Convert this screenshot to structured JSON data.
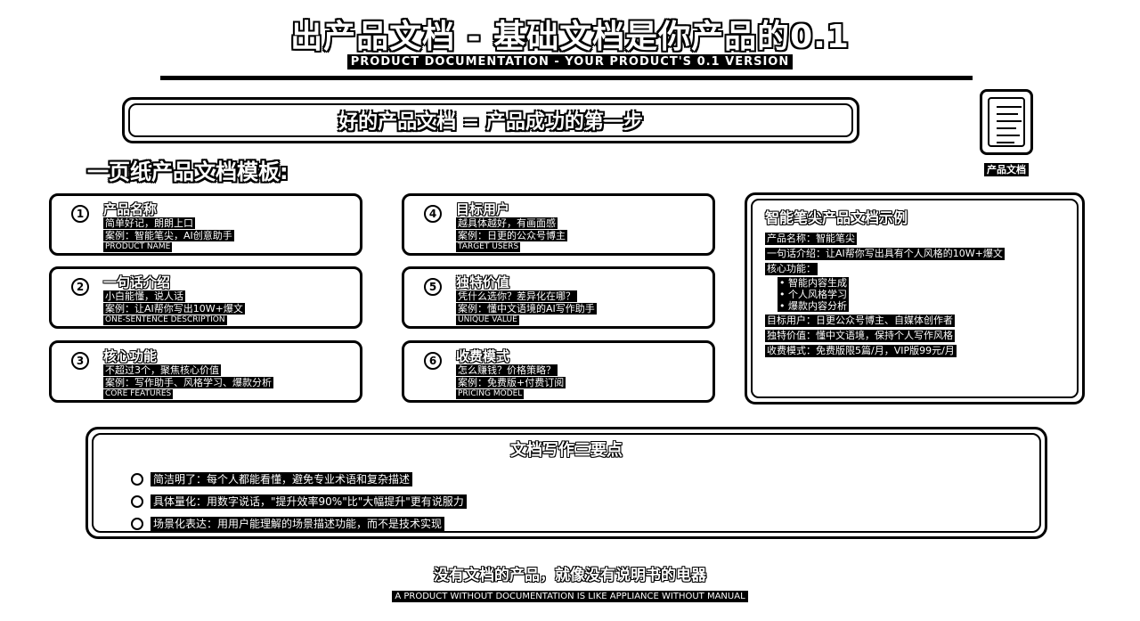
{
  "header": {
    "title": "出产品文档 - 基础文档是你产品的0.1",
    "subtitle": "PRODUCT DOCUMENTATION - YOUR PRODUCT'S 0.1 VERSION"
  },
  "banner": {
    "text": "好的产品文档 = 产品成功的第一步"
  },
  "doc_icon": {
    "icon": "document-icon",
    "label": "产品文档"
  },
  "template_heading": "一页纸产品文档模板:",
  "cards": [
    {
      "num": "1",
      "title": "产品名称",
      "line1": "简单好记，朗朗上口",
      "line2": "案例：智能笔尖，AI创意助手",
      "en": "PRODUCT NAME"
    },
    {
      "num": "2",
      "title": "一句话介绍",
      "line1": "小白能懂，说人话",
      "line2": "案例：让AI帮你写出10W+爆文",
      "en": "ONE-SENTENCE DESCRIPTION"
    },
    {
      "num": "3",
      "title": "核心功能",
      "line1": "不超过3个，聚焦核心价值",
      "line2": "案例：写作助手、风格学习、爆款分析",
      "en": "CORE FEATURES"
    },
    {
      "num": "4",
      "title": "目标用户",
      "line1": "越具体越好，有画面感",
      "line2": "案例：日更的公众号博主",
      "en": "TARGET USERS"
    },
    {
      "num": "5",
      "title": "独特价值",
      "line1": "凭什么选你？差异化在哪？",
      "line2": "案例：懂中文语境的AI写作助手",
      "en": "UNIQUE VALUE"
    },
    {
      "num": "6",
      "title": "收费模式",
      "line1": "怎么赚钱？价格策略？",
      "line2": "案例：免费版+付费订阅",
      "en": "PRICING MODEL"
    }
  ],
  "example": {
    "title": "智能笔尖产品文档示例",
    "name_line": "产品名称：智能笔尖",
    "intro_line": "一句话介绍：让AI帮你写出具有个人风格的10W+爆文",
    "features_label": "核心功能：",
    "features": [
      "• 智能内容生成",
      "• 个人风格学习",
      "• 爆款内容分析"
    ],
    "users_line": "目标用户：日更公众号博主、自媒体创作者",
    "value_line": "独特价值：懂中文语境，保持个人写作风格",
    "pricing_line": "收费模式：免费版限5篇/月，VIP版99元/月"
  },
  "keypoints": {
    "title": "文档写作三要点",
    "items": [
      "简洁明了：每个人都能看懂，避免专业术语和复杂描述",
      "具体量化：用数字说话，\"提升效率90%\"比\"大幅提升\"更有说服力",
      "场景化表达：用用户能理解的场景描述功能，而不是技术实现"
    ]
  },
  "footer": {
    "zh": "没有文档的产品，就像没有说明书的电器",
    "en": "A PRODUCT WITHOUT DOCUMENTATION IS LIKE APPLIANCE WITHOUT MANUAL"
  }
}
